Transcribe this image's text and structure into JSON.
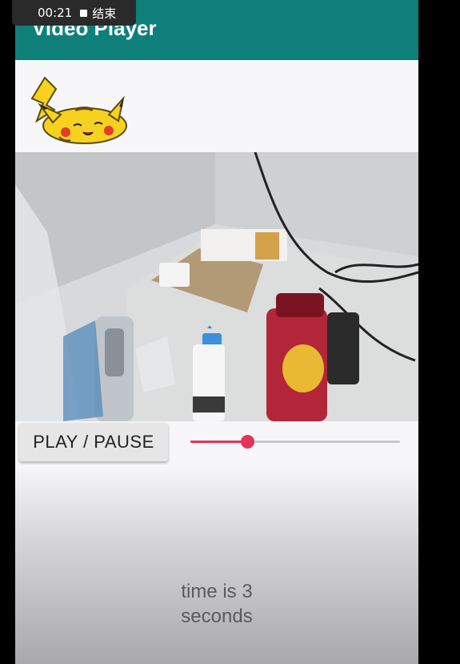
{
  "status_bar": {
    "time": "00:21",
    "stop_label": "结束"
  },
  "app": {
    "title": "Video Player"
  },
  "controls": {
    "play_pause_label": "PLAY / PAUSE",
    "seek_progress_fraction": 0.27
  },
  "time_display": {
    "line1": "time is 3",
    "line2": "seconds"
  },
  "colors": {
    "appbar": "#0f7f7a",
    "accent": "#e0345a",
    "background": "#f7f6f9"
  },
  "icons": {
    "logo": "pikachu-logo",
    "stop": "stop-icon"
  }
}
